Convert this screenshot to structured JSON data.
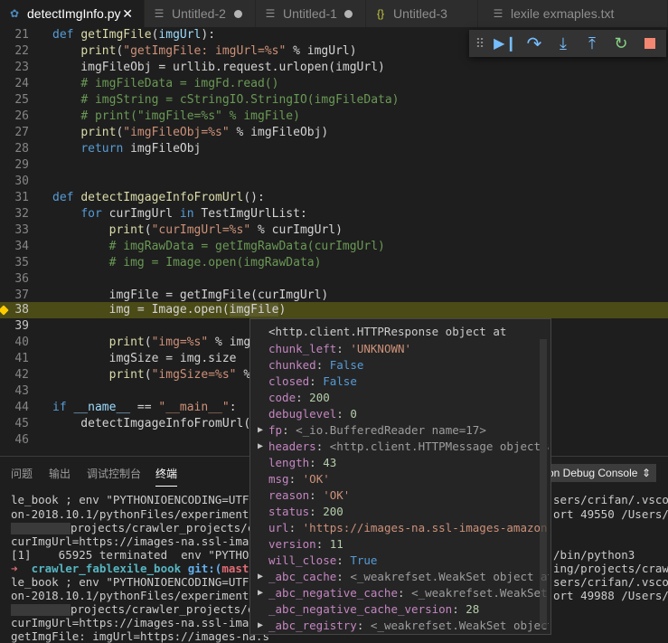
{
  "tabs": [
    {
      "label": "detectImgInfo.py",
      "icon": "python-icon",
      "state": "close"
    },
    {
      "label": "Untitled-2",
      "icon": "file-lines-icon",
      "state": "dirty"
    },
    {
      "label": "Untitled-1",
      "icon": "file-lines-icon",
      "state": "dirty"
    },
    {
      "label": "Untitled-3",
      "icon": "json-braces-icon",
      "state": "none"
    },
    {
      "label": "lexile exmaples.txt",
      "icon": "file-lines-icon",
      "state": "none"
    }
  ],
  "editor": {
    "lines": [
      {
        "n": "21"
      },
      {
        "n": "22"
      },
      {
        "n": "23"
      },
      {
        "n": "24"
      },
      {
        "n": "25"
      },
      {
        "n": "26"
      },
      {
        "n": "27"
      },
      {
        "n": "28"
      },
      {
        "n": "29"
      },
      {
        "n": "30"
      },
      {
        "n": "31"
      },
      {
        "n": "32"
      },
      {
        "n": "33"
      },
      {
        "n": "34"
      },
      {
        "n": "35"
      },
      {
        "n": "36"
      },
      {
        "n": "37"
      },
      {
        "n": "38"
      },
      {
        "n": "39"
      },
      {
        "n": "40"
      },
      {
        "n": "41"
      },
      {
        "n": "42"
      },
      {
        "n": "43"
      },
      {
        "n": "44"
      },
      {
        "n": "45"
      },
      {
        "n": "46"
      }
    ],
    "current_line": "38"
  },
  "debug_toolbar": {
    "buttons": [
      {
        "name": "continue-icon",
        "glyph": "▶"
      },
      {
        "name": "step-over-icon",
        "glyph": "↷"
      },
      {
        "name": "step-into-icon",
        "glyph": "↓"
      },
      {
        "name": "step-out-icon",
        "glyph": "↑"
      },
      {
        "name": "restart-icon",
        "glyph": "↻"
      },
      {
        "name": "stop-icon",
        "glyph": "■"
      }
    ]
  },
  "panel": {
    "tabs": [
      "问题",
      "输出",
      "调试控制台",
      "终端"
    ],
    "active_tab": "终端",
    "console_select": "on Debug Console",
    "terminal_lines": [
      "le_book ; env \"PYTHONIOENCODING=UTF-8\"",
      "on-2018.10.1/pythonFiles/experimental/",
      "projects/crawler_projects/cr",
      "curImgUrl=https://images-na.ssl-images",
      "[1]    65925 terminated  env \"PYTHONIO",
      "crawler_fablexile_book",
      "le_book ; env \"PYTHONIOENCODING=UTF-8\"",
      "on-2018.10.1/pythonFiles/experimental/",
      "projects/crawler_projects/cr",
      "curImgUrl=https://images-na.ssl-images",
      "getImgFile: imgUrl=https://images-na.s"
    ],
    "terminal_right_lines": [
      "sers/crifan/.vscode",
      "ort 49550 /Users/cr",
      "/bin/python3",
      "ing/projects/crawle",
      "sers/crifan/.vscode",
      "ort 49988 /Users/cr"
    ],
    "prompt": {
      "arrow": "➜",
      "dir": "crawler_fablexile_book",
      "git": "git:(",
      "branch": "master",
      ")": ")"
    }
  },
  "hover": {
    "title": "<http.client.HTTPResponse object at",
    "rows": [
      {
        "twisty": "",
        "key": "chunk_left",
        "sep": ": ",
        "value": "'UNKNOWN'",
        "vcolor": "#ce9178"
      },
      {
        "twisty": "",
        "key": "chunked",
        "sep": ": ",
        "value": "False",
        "vcolor": "#569cd6"
      },
      {
        "twisty": "",
        "key": "closed",
        "sep": ": ",
        "value": "False",
        "vcolor": "#569cd6"
      },
      {
        "twisty": "",
        "key": "code",
        "sep": ": ",
        "value": "200",
        "vcolor": "#b5cea8"
      },
      {
        "twisty": "",
        "key": "debuglevel",
        "sep": ": ",
        "value": "0",
        "vcolor": "#b5cea8"
      },
      {
        "twisty": "▶",
        "key": "fp",
        "sep": ": ",
        "value": "<_io.BufferedReader name=17>",
        "vcolor": "#9d9d9d"
      },
      {
        "twisty": "▶",
        "key": "headers",
        "sep": ": ",
        "value": "<http.client.HTTPMessage object at 0x1",
        "vcolor": "#9d9d9d"
      },
      {
        "twisty": "",
        "key": "length",
        "sep": ": ",
        "value": "43",
        "vcolor": "#b5cea8"
      },
      {
        "twisty": "",
        "key": "msg",
        "sep": ": ",
        "value": "'OK'",
        "vcolor": "#ce9178"
      },
      {
        "twisty": "",
        "key": "reason",
        "sep": ": ",
        "value": "'OK'",
        "vcolor": "#ce9178"
      },
      {
        "twisty": "",
        "key": "status",
        "sep": ": ",
        "value": "200",
        "vcolor": "#b5cea8"
      },
      {
        "twisty": "",
        "key": "url",
        "sep": ": ",
        "value": "'https://images-na.ssl-images-amazon.com/i",
        "vcolor": "#ce9178"
      },
      {
        "twisty": "",
        "key": "version",
        "sep": ": ",
        "value": "11",
        "vcolor": "#b5cea8"
      },
      {
        "twisty": "",
        "key": "will_close",
        "sep": ": ",
        "value": "True",
        "vcolor": "#569cd6"
      },
      {
        "twisty": "▶",
        "key": "_abc_cache",
        "sep": ": ",
        "value": "<_weakrefset.WeakSet object at 0x10",
        "vcolor": "#9d9d9d"
      },
      {
        "twisty": "▶",
        "key": "_abc_negative_cache",
        "sep": ": ",
        "value": "<_weakrefset.WeakSet objec",
        "vcolor": "#9d9d9d"
      },
      {
        "twisty": "",
        "key": "_abc_negative_cache_version",
        "sep": ": ",
        "value": "28",
        "vcolor": "#b5cea8"
      },
      {
        "twisty": "▶",
        "key": "_abc_registry",
        "sep": ": ",
        "value": "<_weakrefset.WeakSet object at 0",
        "vcolor": "#9d9d9d"
      }
    ]
  },
  "colors": {
    "accent": "#007acc",
    "current_line": "#4b4b18",
    "breakpoint": "#ffcc00"
  }
}
